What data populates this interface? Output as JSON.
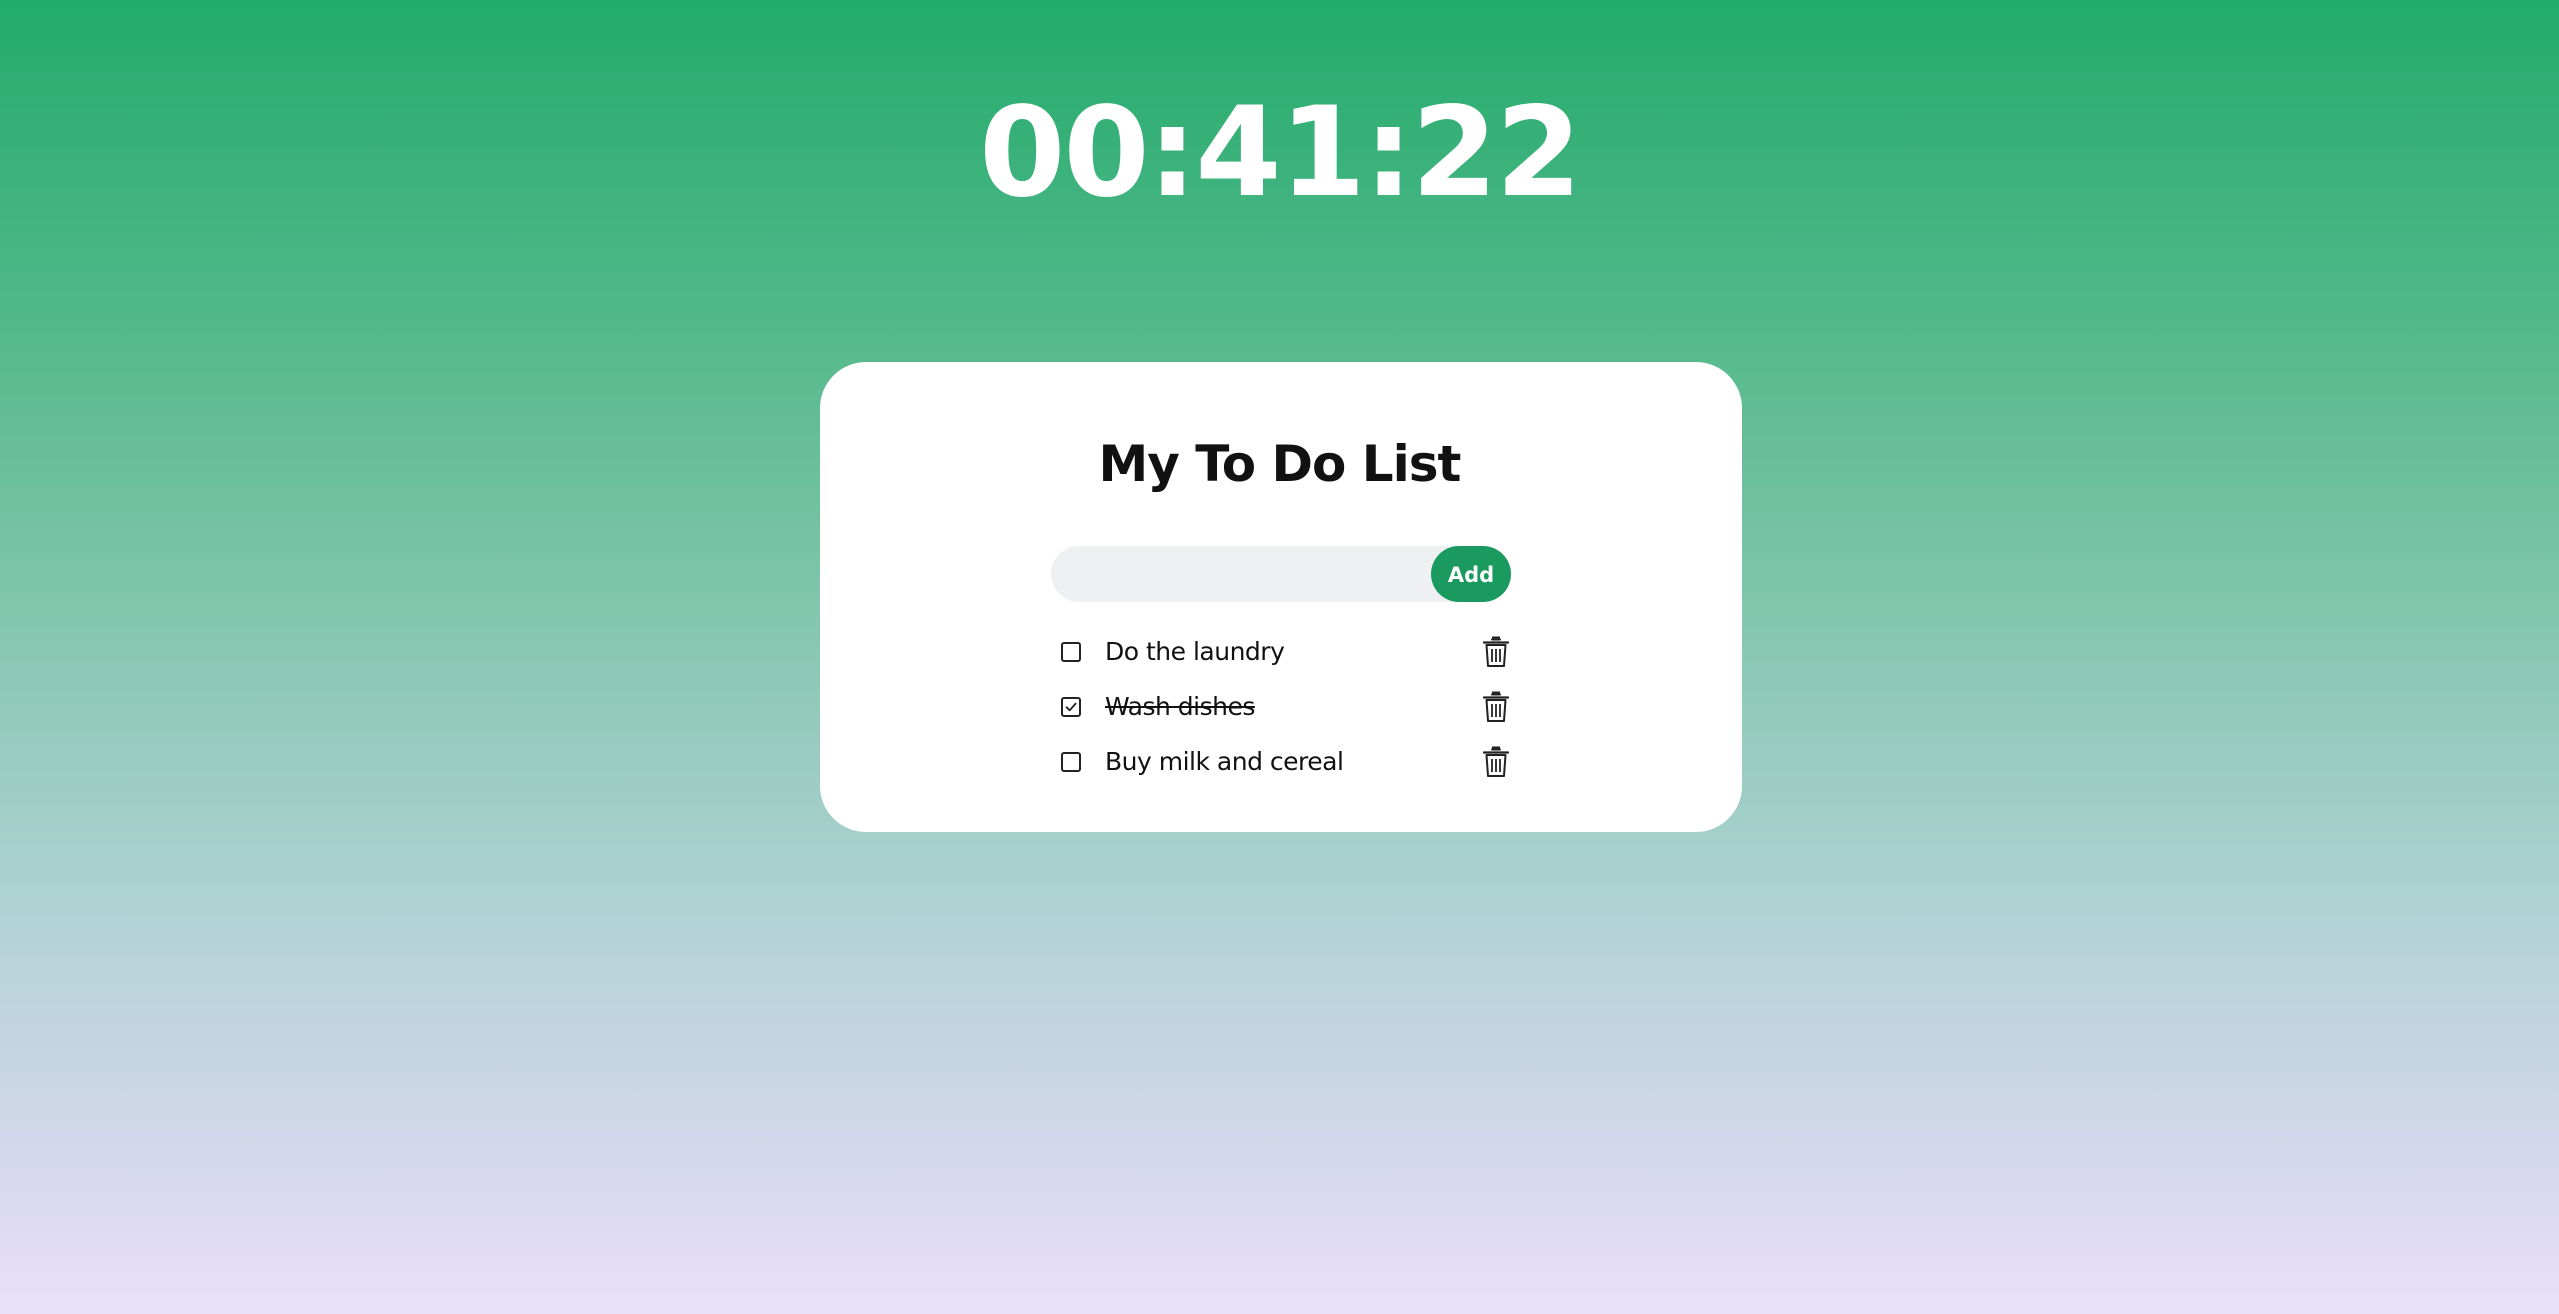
{
  "timer": {
    "display": "00:41:22"
  },
  "todo": {
    "title": "My To Do List",
    "input": {
      "value": "",
      "placeholder": ""
    },
    "add_label": "Add",
    "tasks": [
      {
        "label": "Do the laundry",
        "completed": false
      },
      {
        "label": "Wash dishes",
        "completed": true
      },
      {
        "label": "Buy milk and cereal",
        "completed": false
      }
    ]
  },
  "icons": {
    "checkbox": "checkbox-icon",
    "checkmark": "checkmark-icon",
    "delete": "trash-icon"
  },
  "colors": {
    "accent": "#1a9a5e",
    "background_top": "#22ab6a",
    "background_bottom": "#e9e0fa",
    "card": "#ffffff",
    "input_background": "#eef0f1"
  }
}
